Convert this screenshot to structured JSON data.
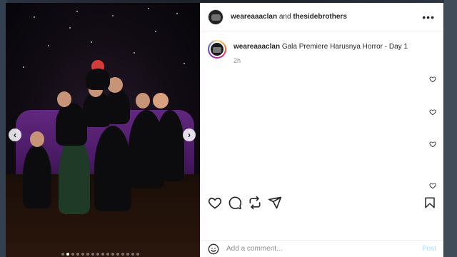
{
  "header": {
    "account_primary": "weareaaaclan",
    "joiner": " and ",
    "account_secondary": "thesidebrothers",
    "more_label": "•••"
  },
  "caption": {
    "username": "weareaaaclan",
    "text": "Gala Premiere Harusnya Horror - Day 1",
    "time": "2h"
  },
  "media": {
    "prev_label": "‹",
    "next_label": "›",
    "carousel_dot_count": 16,
    "active_dot_index": 1
  },
  "actions": {
    "icons": [
      "heart-icon",
      "comment-icon",
      "repost-icon",
      "share-icon",
      "save-icon"
    ]
  },
  "comment_box": {
    "placeholder": "Add a comment...",
    "post_label": "Post"
  },
  "colors": {
    "text": "#262626",
    "muted": "#8e8e8e",
    "post_disabled": "#b2dffc",
    "sofa": "#6a2a8a"
  }
}
